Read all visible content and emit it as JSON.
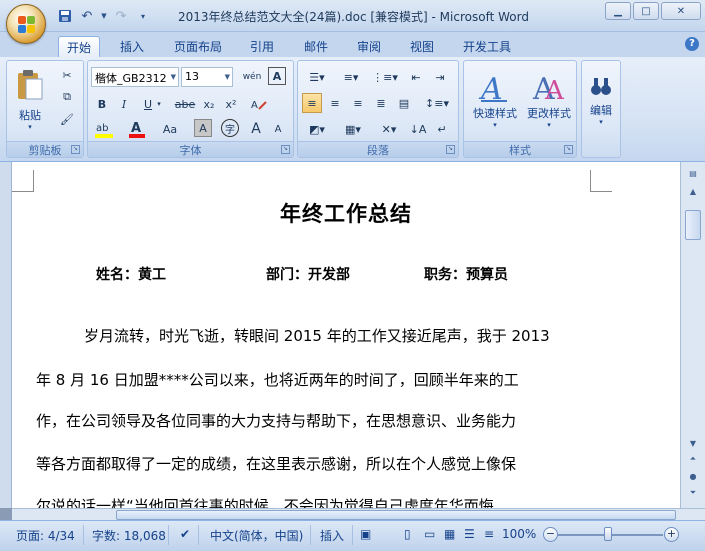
{
  "window": {
    "title": "2013年终总结范文大全(24篇).doc [兼容模式] - Microsoft Word",
    "min_icon": "minimize-icon",
    "max_icon": "maximize-icon",
    "close_icon": "close-icon"
  },
  "qat": {
    "save": "save-icon",
    "undo": "undo-icon",
    "redo": "redo-icon",
    "customize": "customize-icon"
  },
  "tabs": [
    {
      "label": "开始",
      "active": true
    },
    {
      "label": "插入"
    },
    {
      "label": "页面布局"
    },
    {
      "label": "引用"
    },
    {
      "label": "邮件"
    },
    {
      "label": "审阅"
    },
    {
      "label": "视图"
    },
    {
      "label": "开发工具"
    }
  ],
  "ribbon": {
    "clipboard": {
      "label": "剪贴板",
      "paste": "粘贴"
    },
    "font": {
      "label": "字体",
      "font_name": "楷体_GB2312",
      "font_size": "13",
      "wen": "wén",
      "bold": "B",
      "italic": "I",
      "underline": "U",
      "strike": "abe",
      "sub": "x₂",
      "sup": "x²",
      "aa": "Aa",
      "a_box": "A",
      "char_circle": "字",
      "grow": "A",
      "shrink": "A"
    },
    "paragraph": {
      "label": "段落"
    },
    "styles": {
      "label": "样式",
      "quick": "快速样式",
      "change": "更改样式"
    },
    "editing": {
      "label": "编辑"
    }
  },
  "document": {
    "title": "年终工作总结",
    "info": {
      "name": "姓名：黄工",
      "dept": "部门：开发部",
      "role": "职务：预算员"
    },
    "paragraph_lines": [
      "岁月流转，时光飞逝，转眼间 2015 年的工作又接近尾声，我于 2013",
      "年 8 月 16 日加盟****公司以来，也将近两年的时间了，回顾半年来的工",
      "作，在公司领导及各位同事的大力支持与帮助下，在思想意识、业务能力",
      "等各方面都取得了一定的成绩，在这里表示感谢，所以在个人感觉上像保",
      "尔说的话一样“当他回首往事的时候，不会因为觉得自己虚度年华而悔"
    ]
  },
  "status": {
    "page": "页面: 4/34",
    "words": "字数: 18,068",
    "language": "中文(简体，中国)",
    "mode": "插入",
    "zoom": "100%"
  },
  "colors": {
    "accent": "#15428b",
    "ribbon_bg": "#d6e3f4",
    "title_bar": "#c3d6ee"
  }
}
